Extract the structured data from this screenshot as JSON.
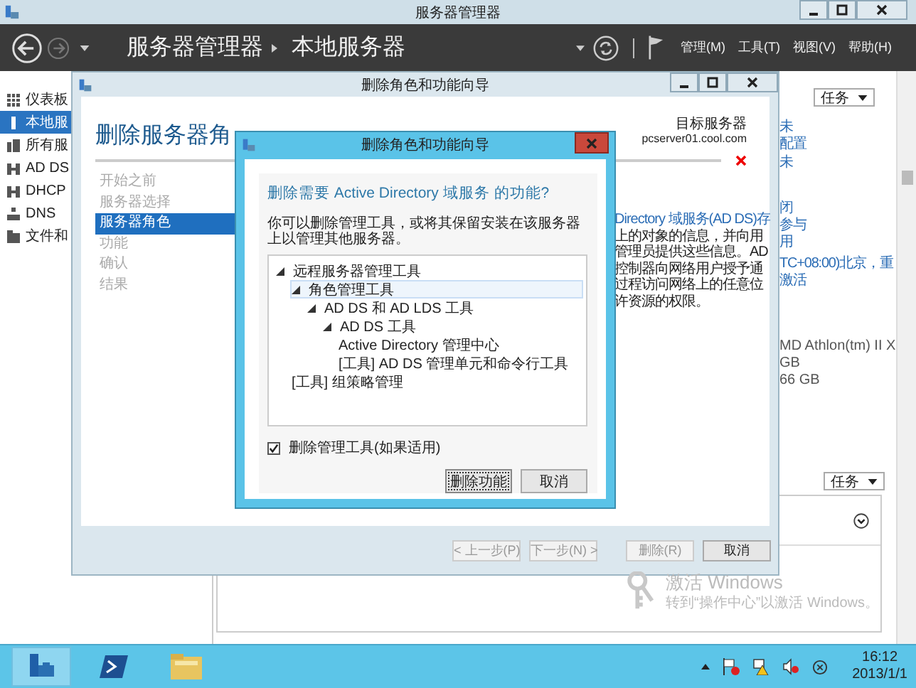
{
  "window": {
    "title": "服务器管理器"
  },
  "header": {
    "breadcrumb": [
      "服务器管理器",
      "本地服务器"
    ],
    "menus": [
      "管理(M)",
      "工具(T)",
      "视图(V)",
      "帮助(H)"
    ]
  },
  "sidebar": {
    "items": [
      {
        "label": "仪表板",
        "kind": "dashboard",
        "selected": false
      },
      {
        "label": "本地服",
        "kind": "server",
        "selected": true
      },
      {
        "label": "所有服",
        "kind": "servers",
        "selected": false
      },
      {
        "label": "AD DS",
        "kind": "role",
        "selected": false
      },
      {
        "label": "DHCP",
        "kind": "role",
        "selected": false
      },
      {
        "label": "DNS",
        "kind": "dns",
        "selected": false
      },
      {
        "label": "文件和",
        "kind": "files",
        "selected": false
      }
    ]
  },
  "properties": {
    "task_button": "任务",
    "links": [
      "未",
      "配置",
      "未",
      "闭",
      "参与",
      "用",
      "TC+08:00)北京，重",
      "激活"
    ],
    "values": [
      "MD Athlon(tm) II X",
      "GB",
      "66 GB"
    ]
  },
  "events": {
    "task_button": "任务"
  },
  "wizard": {
    "title": "删除角色和功能向导",
    "heading": "删除服务器角",
    "target_label": "目标服务器",
    "target_server": "pcserver01.cool.com",
    "steps": [
      {
        "label": "开始之前",
        "selected": false
      },
      {
        "label": "服务器选择",
        "selected": false
      },
      {
        "label": "服务器角色",
        "selected": true
      },
      {
        "label": "功能",
        "selected": false
      },
      {
        "label": "确认",
        "selected": false
      },
      {
        "label": "结果",
        "selected": false
      }
    ],
    "description_lines": [
      "Directory 域服务(AD DS)存",
      "上的对象的信息，并向用",
      "管理员提供这些信息。AD",
      "控制器向网络用户授予通",
      "过程访问网络上的任意位",
      "许资源的权限。"
    ],
    "buttons": [
      {
        "label": "< 上一步(P)",
        "disabled": true
      },
      {
        "label": "下一步(N) >",
        "disabled": true
      },
      {
        "label": "删除(R)",
        "disabled": true
      },
      {
        "label": "取消",
        "disabled": false
      }
    ]
  },
  "dialog": {
    "title": "删除角色和功能向导",
    "question": "删除需要 Active Directory 域服务 的功能?",
    "description": "你可以删除管理工具，或将其保留安装在该服务器上以管理其他服务器。",
    "tree": [
      {
        "label": "远程服务器管理工具",
        "expanded": true,
        "selected": false,
        "children": [
          {
            "label": "角色管理工具",
            "expanded": true,
            "selected": true,
            "children": [
              {
                "label": "AD DS 和 AD LDS 工具",
                "expanded": true,
                "selected": false,
                "children": [
                  {
                    "label": "AD DS 工具",
                    "expanded": true,
                    "selected": false,
                    "children": [
                      {
                        "label": "Active Directory 管理中心",
                        "selected": false
                      },
                      {
                        "label": "[工具] AD DS 管理单元和命令行工具",
                        "selected": false
                      }
                    ]
                  }
                ]
              }
            ]
          },
          {
            "label": "[工具] 组策略管理",
            "selected": false
          }
        ]
      }
    ],
    "checkbox": {
      "label": "删除管理工具(如果适用)",
      "checked": true
    },
    "buttons": [
      {
        "label": "删除功能",
        "focused": true
      },
      {
        "label": "取消",
        "focused": false
      }
    ]
  },
  "activation": {
    "title": "激活 Windows",
    "subtitle": "转到“操作中心”以激活 Windows。"
  },
  "taskbar": {
    "apps": [
      {
        "kind": "server-manager",
        "selected": true
      },
      {
        "kind": "powershell",
        "selected": false
      },
      {
        "kind": "explorer",
        "selected": false
      }
    ],
    "time": "16:12",
    "date": "2013/1/1"
  }
}
